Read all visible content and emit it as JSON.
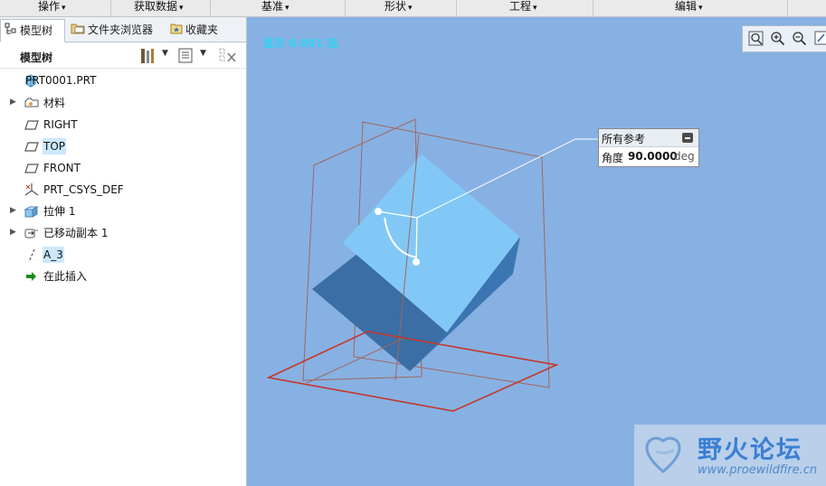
{
  "menubar": {
    "items": [
      {
        "label": "操作"
      },
      {
        "label": "获取数据"
      },
      {
        "label": "基准"
      },
      {
        "label": "形状"
      },
      {
        "label": "工程"
      },
      {
        "label": "编辑"
      }
    ]
  },
  "tabs": [
    {
      "label": "模型树",
      "icon": "model-tree-icon",
      "active": true
    },
    {
      "label": "文件夹浏览器",
      "icon": "folder-browser-icon",
      "active": false
    },
    {
      "label": "收藏夹",
      "icon": "favorites-icon",
      "active": false
    }
  ],
  "tree": {
    "header": "模型树",
    "items": [
      {
        "label": "PRT0001.PRT",
        "icon": "part-icon",
        "expandable": false,
        "selected": false
      },
      {
        "label": "材料",
        "icon": "material-icon",
        "expandable": true,
        "selected": false
      },
      {
        "label": "RIGHT",
        "icon": "datum-plane-icon",
        "expandable": false,
        "selected": false
      },
      {
        "label": "TOP",
        "icon": "datum-plane-icon",
        "expandable": false,
        "selected": true
      },
      {
        "label": "FRONT",
        "icon": "datum-plane-icon",
        "expandable": false,
        "selected": false
      },
      {
        "label": "PRT_CSYS_DEF",
        "icon": "coordinate-system-icon",
        "expandable": false,
        "selected": false
      },
      {
        "label": "拉伸 1",
        "icon": "extrude-icon",
        "expandable": true,
        "selected": false
      },
      {
        "label": "已移动副本 1",
        "icon": "moved-copy-icon",
        "expandable": true,
        "selected": false
      },
      {
        "label": "A_3",
        "icon": "datum-axis-icon",
        "expandable": false,
        "selected": true
      },
      {
        "label": "在此插入",
        "icon": "insert-here-arrow-icon",
        "expandable": false,
        "selected": false
      }
    ]
  },
  "viewport": {
    "status_text": "显示 0.001 选",
    "background": "#87b1e3"
  },
  "callout": {
    "title": "所有参考",
    "angle_label": "角度",
    "angle_value": "90.0000",
    "angle_unit": "deg"
  },
  "watermark": {
    "text": "野火论坛",
    "url": "www.proewildfire.cn"
  },
  "colors": {
    "cube_top": "#82c8f7",
    "cube_front": "#3a6ea4",
    "datum_plane": "#a0665e",
    "datum_plane_selected": "#c4382b",
    "selection_highlight": "#cce8ff"
  }
}
